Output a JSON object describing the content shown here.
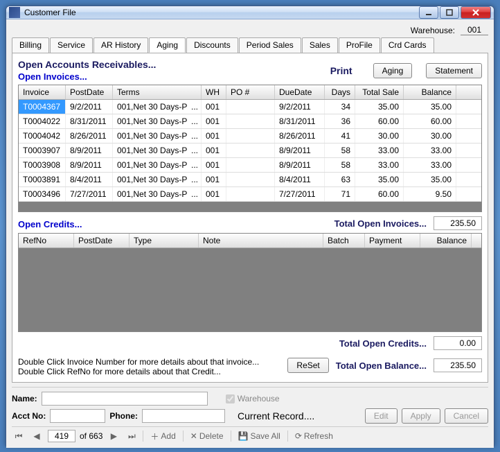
{
  "window": {
    "title": "Customer File"
  },
  "warehouse": {
    "label": "Warehouse:",
    "value": "001"
  },
  "tabs": [
    "Billing",
    "Service",
    "AR History",
    "Aging",
    "Discounts",
    "Period Sales",
    "Sales",
    "ProFile",
    "Crd Cards"
  ],
  "active_tab": "Aging",
  "headings": {
    "main": "Open Accounts Receivables...",
    "invoices": "Open Invoices...",
    "credits": "Open Credits...",
    "print": "Print"
  },
  "buttons": {
    "aging": "Aging",
    "statement": "Statement",
    "reset": "ReSet",
    "edit": "Edit",
    "apply": "Apply",
    "cancel": "Cancel"
  },
  "invoice_cols": {
    "invoice": "Invoice",
    "postdate": "PostDate",
    "terms": "Terms",
    "wh": "WH",
    "po": "PO #",
    "due": "DueDate",
    "days": "Days",
    "sale": "Total Sale",
    "balance": "Balance"
  },
  "invoices": [
    {
      "invoice": "T0004367",
      "postdate": "9/2/2011",
      "terms": "001,Net 30 Days-P",
      "wh": "001",
      "po": "",
      "due": "9/2/2011",
      "days": "34",
      "sale": "35.00",
      "balance": "35.00"
    },
    {
      "invoice": "T0004022",
      "postdate": "8/31/2011",
      "terms": "001,Net 30 Days-P",
      "wh": "001",
      "po": "",
      "due": "8/31/2011",
      "days": "36",
      "sale": "60.00",
      "balance": "60.00"
    },
    {
      "invoice": "T0004042",
      "postdate": "8/26/2011",
      "terms": "001,Net 30 Days-P",
      "wh": "001",
      "po": "",
      "due": "8/26/2011",
      "days": "41",
      "sale": "30.00",
      "balance": "30.00"
    },
    {
      "invoice": "T0003907",
      "postdate": "8/9/2011",
      "terms": "001,Net 30 Days-P",
      "wh": "001",
      "po": "",
      "due": "8/9/2011",
      "days": "58",
      "sale": "33.00",
      "balance": "33.00"
    },
    {
      "invoice": "T0003908",
      "postdate": "8/9/2011",
      "terms": "001,Net 30 Days-P",
      "wh": "001",
      "po": "",
      "due": "8/9/2011",
      "days": "58",
      "sale": "33.00",
      "balance": "33.00"
    },
    {
      "invoice": "T0003891",
      "postdate": "8/4/2011",
      "terms": "001,Net 30 Days-P",
      "wh": "001",
      "po": "",
      "due": "8/4/2011",
      "days": "63",
      "sale": "35.00",
      "balance": "35.00"
    },
    {
      "invoice": "T0003496",
      "postdate": "7/27/2011",
      "terms": "001,Net 30 Days-P",
      "wh": "001",
      "po": "",
      "due": "7/27/2011",
      "days": "71",
      "sale": "60.00",
      "balance": "9.50"
    }
  ],
  "credit_cols": {
    "ref": "RefNo",
    "postdate": "PostDate",
    "type": "Type",
    "note": "Note",
    "batch": "Batch",
    "payment": "Payment",
    "balance": "Balance"
  },
  "totals": {
    "invoices_label": "Total Open Invoices...",
    "invoices_val": "235.50",
    "credits_label": "Total Open Credits...",
    "credits_val": "0.00",
    "balance_label": "Total Open Balance...",
    "balance_val": "235.50"
  },
  "hints": {
    "l1": "Double Click Invoice Number for more details about that invoice...",
    "l2": "Double Click RefNo for more details about that Credit..."
  },
  "status": {
    "name_label": "Name:",
    "acct_label": "Acct No:",
    "phone_label": "Phone:",
    "warehouse_chk": "Warehouse",
    "current_record": "Current Record...."
  },
  "nav": {
    "pos": "419",
    "of": "of 663",
    "add": "Add",
    "delete": "Delete",
    "save": "Save All",
    "refresh": "Refresh"
  }
}
